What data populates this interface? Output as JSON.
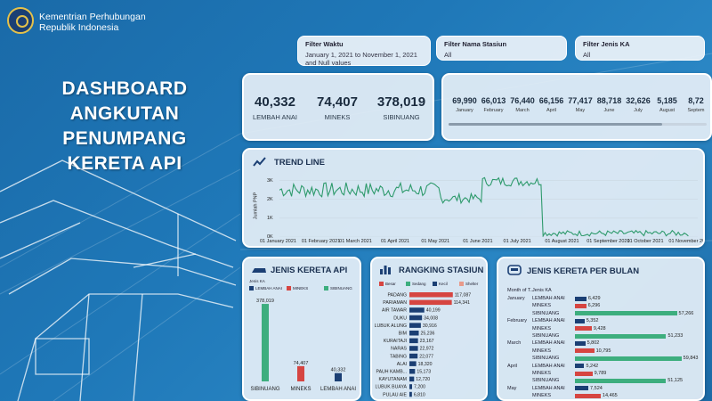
{
  "header": {
    "org_line1": "Kementrian Perhubungan",
    "org_line2": "Republik Indonesia",
    "title_line1": "DASHBOARD ANGKUTAN",
    "title_line2": "PENUMPANG KERETA API"
  },
  "filters": {
    "waktu": {
      "label": "Filter Waktu",
      "value": "January 1, 2021 to November 1, 2021",
      "value2": "and Null values"
    },
    "stasiun": {
      "label": "Filter Nama Stasiun",
      "value": "All"
    },
    "jenis": {
      "label": "Filter Jenis KA",
      "value": "All"
    }
  },
  "kpis": [
    {
      "value": "40,332",
      "label": "LEMBAH ANAI"
    },
    {
      "value": "74,407",
      "label": "MINEKS"
    },
    {
      "value": "378,019",
      "label": "SIBINUANG"
    }
  ],
  "monthly_totals": [
    {
      "value": "69,990",
      "label": "January"
    },
    {
      "value": "66,013",
      "label": "February"
    },
    {
      "value": "76,440",
      "label": "March"
    },
    {
      "value": "66,156",
      "label": "April"
    },
    {
      "value": "77,417",
      "label": "May"
    },
    {
      "value": "88,718",
      "label": "June"
    },
    {
      "value": "32,626",
      "label": "July"
    },
    {
      "value": "5,185",
      "label": "August"
    },
    {
      "value": "8,72",
      "label": "Septem"
    }
  ],
  "trend": {
    "title": "TREND LINE",
    "ylabel": "Jumlah PNP",
    "yticks": [
      "3K",
      "2K",
      "1K",
      "0K"
    ],
    "xticks": [
      "01 January 2021",
      "01 February 2021",
      "01 March 2021",
      "01 April 2021",
      "01 May 2021",
      "01 June 2021",
      "01 July 2021",
      "01 August 2021",
      "01 September 2021",
      "01 October 2021",
      "01 November 2021"
    ],
    "color": "#2e9a6c"
  },
  "jenis_ka": {
    "title": "JENIS KERETA API",
    "legend_title": "Jenis KA",
    "legend": [
      "LEMBAH ANAI",
      "MINEKS",
      "SIBINUANG"
    ],
    "colors": [
      "#1b3f74",
      "#d64541",
      "#3dae7e"
    ]
  },
  "rangking": {
    "title": "RANGKING STASIUN",
    "legend": [
      "Besar",
      "Sedang",
      "Kecil",
      "Shelter"
    ],
    "legend_colors": [
      "#d64541",
      "#3dae7e",
      "#1b3f74",
      "#e89a8a"
    ]
  },
  "per_bulan": {
    "title": "JENIS KERETA PER BULAN",
    "col1": "Month of T...",
    "col2": "Jenis KA",
    "rows": [
      {
        "month": "January",
        "jenis": "LEMBAH ANAI",
        "value": 6429,
        "label": "6,429"
      },
      {
        "month": "",
        "jenis": "MINEKS",
        "value": 6296,
        "label": "6,296"
      },
      {
        "month": "",
        "jenis": "SIBINUANG",
        "value": 57266,
        "label": "57,266"
      },
      {
        "month": "February",
        "jenis": "LEMBAH ANAI",
        "value": 5352,
        "label": "5,352"
      },
      {
        "month": "",
        "jenis": "MINEKS",
        "value": 9428,
        "label": "9,428"
      },
      {
        "month": "",
        "jenis": "SIBINUANG",
        "value": 51233,
        "label": "51,233"
      },
      {
        "month": "March",
        "jenis": "LEMBAH ANAI",
        "value": 5802,
        "label": "5,802"
      },
      {
        "month": "",
        "jenis": "MINEKS",
        "value": 10795,
        "label": "10,795"
      },
      {
        "month": "",
        "jenis": "SIBINUANG",
        "value": 59843,
        "label": "59,843"
      },
      {
        "month": "April",
        "jenis": "LEMBAH ANAI",
        "value": 5242,
        "label": "5,242"
      },
      {
        "month": "",
        "jenis": "MINEKS",
        "value": 9789,
        "label": "9,789"
      },
      {
        "month": "",
        "jenis": "SIBINUANG",
        "value": 51125,
        "label": "51,125"
      },
      {
        "month": "May",
        "jenis": "LEMBAH ANAI",
        "value": 7524,
        "label": "7,524"
      },
      {
        "month": "",
        "jenis": "MINEKS",
        "value": 14465,
        "label": "14,465"
      }
    ]
  },
  "chart_data": [
    {
      "type": "bar",
      "title": "JENIS KERETA API",
      "categories": [
        "SIBINUANG",
        "MINEKS",
        "LEMBAH ANAI"
      ],
      "values": [
        378019,
        74407,
        40332
      ],
      "value_labels": [
        "378,019",
        "74,407",
        "40,332"
      ],
      "colors": [
        "#3dae7e",
        "#d64541",
        "#1b3f74"
      ]
    },
    {
      "type": "bar",
      "title": "RANGKING STASIUN",
      "categories": [
        "PADANG",
        "PARIAMAN",
        "AIR TAWAR",
        "DUKU",
        "LUBUK ALUNG",
        "BIM",
        "KURAITAJI",
        "NARAS",
        "TABING",
        "ALAI",
        "PAUH KAMB...",
        "KAYUTANAM",
        "LUBUK BUAYA",
        "PULAU AIE"
      ],
      "values": [
        117087,
        114341,
        40199,
        34008,
        30916,
        25236,
        23167,
        22972,
        22077,
        18320,
        15173,
        12720,
        7200,
        6810
      ],
      "value_labels": [
        "117,087",
        "114,341",
        "40,199",
        "34,008",
        "30,916",
        "25,236",
        "23,167",
        "22,972",
        "22,077",
        "18,320",
        "15,173",
        "12,720",
        "7,200",
        "6,810"
      ],
      "colors": [
        "#d64541",
        "#d64541",
        "#1b3f74",
        "#1b3f74",
        "#1b3f74",
        "#1b3f74",
        "#1b3f74",
        "#1b3f74",
        "#1b3f74",
        "#1b3f74",
        "#1b3f74",
        "#1b3f74",
        "#1b3f74",
        "#1b3f74"
      ]
    },
    {
      "type": "line",
      "title": "TREND LINE",
      "ylabel": "Jumlah PNP",
      "ylim": [
        0,
        3500
      ],
      "segments": [
        {
          "x_start": "2021-01-01",
          "x_end": "2021-04-30",
          "values_low": 2100,
          "values_high": 2900
        },
        {
          "x_start": "2021-05-01",
          "x_end": "2021-05-31",
          "values_low": 1800,
          "values_high": 2300
        },
        {
          "x_start": "2021-06-01",
          "x_end": "2021-07-15",
          "values_low": 2700,
          "values_high": 3200
        },
        {
          "x_start": "2021-07-16",
          "x_end": "2021-11-01",
          "values_low": 50,
          "values_high": 350
        }
      ]
    }
  ]
}
